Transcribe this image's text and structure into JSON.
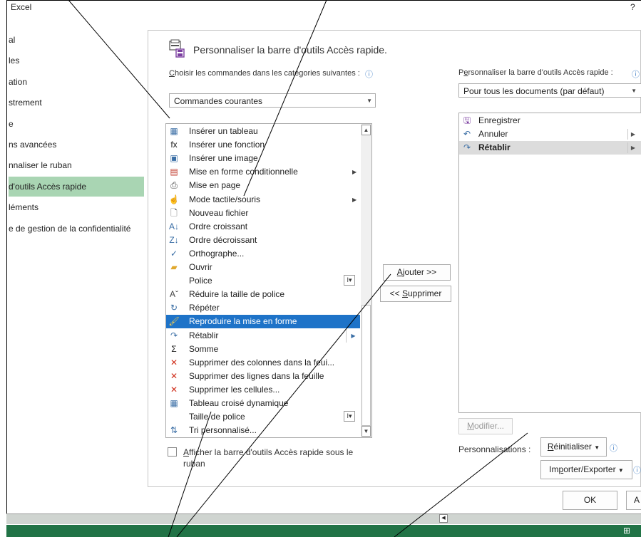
{
  "window": {
    "title": "Excel",
    "help": "?"
  },
  "sidebar": {
    "items": [
      {
        "label": "al",
        "active": false
      },
      {
        "label": "les",
        "active": false
      },
      {
        "label": "ation",
        "active": false
      },
      {
        "label": "strement",
        "active": false
      },
      {
        "label": "e",
        "active": false
      },
      {
        "label": "ns avancées",
        "active": false
      },
      {
        "label": "nnaliser le ruban",
        "active": false
      },
      {
        "label": "d'outils Accès rapide",
        "active": true
      },
      {
        "label": "léments",
        "active": false
      },
      {
        "label": "e de gestion de la confidentialité",
        "active": false
      }
    ]
  },
  "panel": {
    "title": "Personnaliser la barre d'outils Accès rapide.",
    "choose_label": "Choisir les commandes dans les catégories suivantes :",
    "choose_access_key": "C",
    "choose_rest": "hoisir les commandes dans les catégories suivantes :",
    "info_glyph": "ⓘ",
    "category_value": "Commandes courantes",
    "commands": [
      {
        "label": "Insérer un tableau",
        "icon": "table-icon",
        "glyph": "▦",
        "color": "#3a6ea5"
      },
      {
        "label": "Insérer une fonction",
        "icon": "function-icon",
        "glyph": "fx",
        "color": "#222"
      },
      {
        "label": "Insérer une image",
        "icon": "picture-icon",
        "glyph": "▣",
        "color": "#3a6ea5"
      },
      {
        "label": "Mise en forme conditionnelle",
        "icon": "conditional-format-icon",
        "glyph": "▤",
        "color": "#c0392b",
        "submenu": true
      },
      {
        "label": "Mise en page",
        "icon": "page-setup-icon",
        "glyph": "⎙",
        "color": "#444"
      },
      {
        "label": "Mode tactile/souris",
        "icon": "touch-mode-icon",
        "glyph": "☝",
        "color": "#444",
        "submenu": true
      },
      {
        "label": "Nouveau fichier",
        "icon": "new-file-icon",
        "glyph": "🗋",
        "color": "#444"
      },
      {
        "label": "Ordre croissant",
        "icon": "sort-ascending-icon",
        "glyph": "A↓",
        "color": "#3a6ea5"
      },
      {
        "label": "Ordre décroissant",
        "icon": "sort-descending-icon",
        "glyph": "Z↓",
        "color": "#3a6ea5"
      },
      {
        "label": "Orthographe...",
        "icon": "spelling-icon",
        "glyph": "✓",
        "color": "#3a6ea5"
      },
      {
        "label": "Ouvrir",
        "icon": "open-folder-icon",
        "glyph": "▰",
        "color": "#e0a82e"
      },
      {
        "label": "Police",
        "icon": "font-icon",
        "glyph": "",
        "color": "#444",
        "box": "I▾"
      },
      {
        "label": "Réduire la taille de police",
        "icon": "decrease-font-icon",
        "glyph": "Aˇ",
        "color": "#444"
      },
      {
        "label": "Répéter",
        "icon": "repeat-icon",
        "glyph": "↻",
        "color": "#3a6ea5"
      },
      {
        "label": "Reproduire la mise en forme",
        "icon": "format-painter-icon",
        "glyph": "🖌",
        "color": "#e0a82e",
        "selected": true
      },
      {
        "label": "Rétablir",
        "icon": "redo-icon",
        "glyph": "↷",
        "color": "#3a6ea5",
        "split": true
      },
      {
        "label": "Somme",
        "icon": "sum-icon",
        "glyph": "Σ",
        "color": "#222"
      },
      {
        "label": "Supprimer des colonnes dans la feui...",
        "icon": "delete-columns-icon",
        "glyph": "✕",
        "color": "#d0301d"
      },
      {
        "label": "Supprimer des lignes dans la feuille",
        "icon": "delete-rows-icon",
        "glyph": "✕",
        "color": "#d0301d"
      },
      {
        "label": "Supprimer les cellules...",
        "icon": "delete-cells-icon",
        "glyph": "✕",
        "color": "#d0301d"
      },
      {
        "label": "Tableau croisé dynamique",
        "icon": "pivot-table-icon",
        "glyph": "▦",
        "color": "#3a6ea5"
      },
      {
        "label": "Taille de police",
        "icon": "font-size-icon",
        "glyph": "",
        "color": "#444",
        "box": "I▾"
      },
      {
        "label": "Tri personnalisé...",
        "icon": "custom-sort-icon",
        "glyph": "⇅",
        "color": "#3a6ea5"
      }
    ],
    "show_below_label": "Afficher la barre d'outils Accès rapide sous le ruban",
    "show_below_access_key": "A",
    "show_below_rest": "fficher la barre d'outils Accès rapide sous le ruban",
    "add_label": "Ajouter >>",
    "add_access_key": "A",
    "add_rest": "jouter >>",
    "remove_prefix": "<< ",
    "remove_access_key": "S",
    "remove_rest": "upprimer",
    "customize_prefix": "P",
    "customize_access_key": "e",
    "customize_rest": "rsonnaliser la barre d'outils Accès rapide :",
    "scope_value": "Pour tous les documents (par défaut)",
    "qat_items": [
      {
        "label": "Enregistrer",
        "icon": "save-icon",
        "glyph": "🖫",
        "color": "#7b3fa0"
      },
      {
        "label": "Annuler",
        "icon": "undo-icon",
        "glyph": "↶",
        "color": "#3a6ea5",
        "split": true
      },
      {
        "label": "Rétablir",
        "icon": "redo-icon",
        "glyph": "↷",
        "color": "#3a6ea5",
        "split": true,
        "selected": true
      }
    ],
    "modify_access_key": "M",
    "modify_rest": "odifier...",
    "personalisations_label": "Personnalisations :",
    "reset_access_key": "R",
    "reset_rest": "éinitialiser",
    "import_prefix": "Im",
    "import_access_key": "p",
    "import_rest": "orter/Exporter",
    "ok_label": "OK",
    "cancel_partial": "A"
  }
}
